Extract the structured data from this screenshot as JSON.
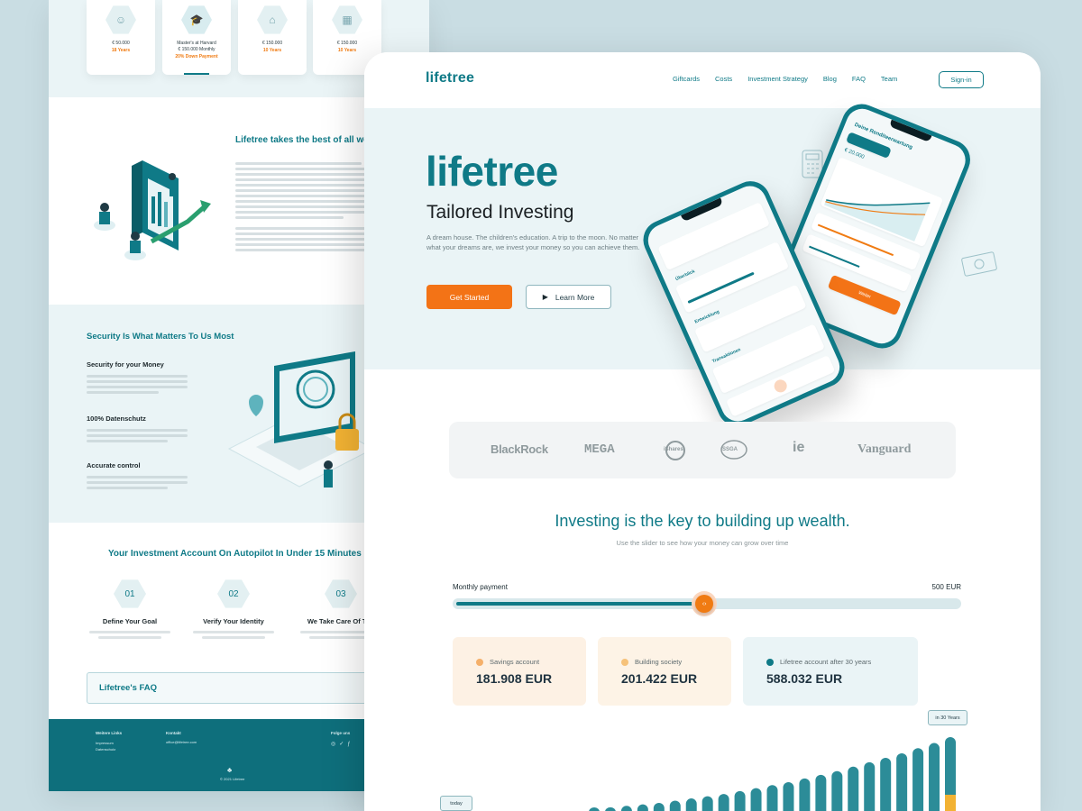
{
  "back_page": {
    "plan_cards": [
      {
        "icon": "child-icon",
        "value": "€ 50.000",
        "years": "18 Years"
      },
      {
        "icon": "graduation-cap-icon",
        "title_line1": "Master's at Harvard",
        "value": "€ 150.000 Monthly",
        "years": "20% Down Payment"
      },
      {
        "icon": "house-icon",
        "value": "€ 150.000",
        "years": "10 Years"
      },
      {
        "icon": "building-icon",
        "value": "€ 150.000",
        "years": "10 Years"
      }
    ],
    "best_of_title": "Lifetree takes the best of all wo",
    "security": {
      "title": "Security Is What Matters To Us Most",
      "items": [
        {
          "title": "Security for your Money"
        },
        {
          "title": "100% Datenschutz"
        },
        {
          "title": "Accurate control"
        }
      ]
    },
    "autopilot": {
      "title": "Your Investment Account On Autopilot In Under 15 Minutes",
      "steps": [
        {
          "num": "01",
          "title": "Define Your Goal"
        },
        {
          "num": "02",
          "title": "Verify Your Identity"
        },
        {
          "num": "03",
          "title": "We Take Care Of The"
        }
      ]
    },
    "faq_label": "Lifetree's FAQ",
    "footer": {
      "col1_title": "Weitere Links",
      "col1_links": [
        "Impressum",
        "Datenschutz"
      ],
      "col2_title": "Kontakt",
      "col2_email": "office@lifetree.com",
      "col3_title": "Folge uns",
      "copyright": "© 2021 Lifetree"
    }
  },
  "nav": {
    "logo": "lifetree",
    "links": [
      "Giftcards",
      "Costs",
      "Investment Strategy",
      "Blog",
      "FAQ",
      "Team"
    ],
    "signin": "Sign-in"
  },
  "hero": {
    "logo": "lifetree",
    "headline": "Tailored Investing",
    "description": "A dream house. The children's education. A trip to the moon. No matter what your dreams are, we invest your money so you can achieve them.",
    "primary_button": "Get Started",
    "secondary_button": "Learn More",
    "phone_back_title": "Deine Renditeerwartung",
    "phone_back_amount": "€ 20.000",
    "phone_back_button": "Weiter",
    "phone_front_items": [
      "Überblick",
      "Entwicklung",
      "Transaktionen"
    ]
  },
  "partners": [
    "BlackRock",
    "MEGA",
    "iShares",
    "SSGA",
    "ie",
    "Vanguard"
  ],
  "wealth": {
    "title": "Investing is the key to building up wealth.",
    "subtitle": "Use the slider to see how your money can grow over time",
    "slider_label": "Monthly payment",
    "slider_value": "500 EUR",
    "slider_fraction": 0.495
  },
  "results": [
    {
      "label": "Savings account",
      "value": "181.908 EUR",
      "dot_color": "#f5b06a",
      "bg": "#fdf1e4"
    },
    {
      "label": "Building society",
      "value": "201.422 EUR",
      "dot_color": "#f6c27a",
      "bg": "#fdf3e6"
    },
    {
      "label": "Lifetree account after 30 years",
      "value": "588.032 EUR",
      "dot_color": "#0f7a87",
      "bg": "#eaf4f6"
    }
  ],
  "growth_chart": {
    "start_label": "today",
    "end_label": "in 30 Years",
    "bar_heights": [
      0.03,
      0.05,
      0.07,
      0.09,
      0.11,
      0.14,
      0.17,
      0.2,
      0.23,
      0.27,
      0.31,
      0.35,
      0.39,
      0.44,
      0.49,
      0.54,
      0.6,
      0.66,
      0.72,
      0.78,
      0.85,
      0.92,
      1.0
    ]
  },
  "colors": {
    "brand": "#0f7a87",
    "accent": "#f37316"
  }
}
